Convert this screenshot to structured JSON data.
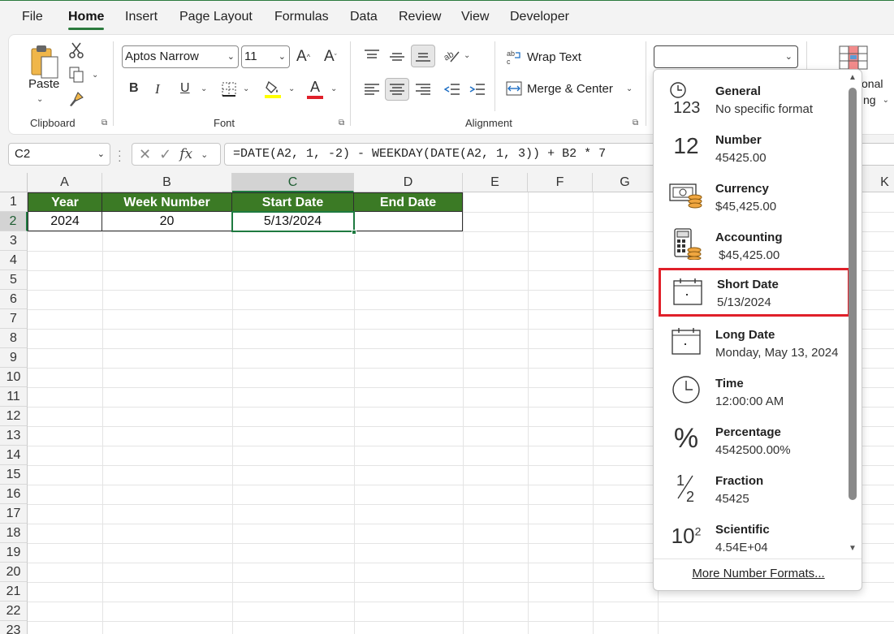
{
  "tabs": [
    "File",
    "Home",
    "Insert",
    "Page Layout",
    "Formulas",
    "Data",
    "Review",
    "View",
    "Developer"
  ],
  "ribbon": {
    "clipboard": {
      "paste_label": "Paste",
      "group_label": "Clipboard"
    },
    "font": {
      "font_name": "Aptos Narrow",
      "font_size": "11",
      "group_label": "Font",
      "bold": "B",
      "italic": "I",
      "underline": "U",
      "grow": "A",
      "shrink": "A",
      "font_color_letter": "A"
    },
    "alignment": {
      "wrap_text": "Wrap Text",
      "merge_center": "Merge & Center",
      "group_label": "Alignment"
    },
    "number": {
      "format_value": ""
    },
    "styles": {
      "conditional_partial_1": "onal",
      "conditional_partial_2": "ng"
    },
    "colors": {
      "fill_color": "#ffff00",
      "font_color": "#e0202a",
      "accent": "#2b7a3d"
    }
  },
  "formula_bar": {
    "name_box": "C2",
    "fx": "fx",
    "formula": "=DATE(A2, 1, -2) - WEEKDAY(DATE(A2, 1, 3)) + B2 * 7"
  },
  "grid": {
    "columns": [
      "A",
      "B",
      "C",
      "D",
      "E",
      "F",
      "G",
      "K"
    ],
    "rows": [
      "1",
      "2",
      "3",
      "4",
      "5",
      "6",
      "7",
      "8",
      "9",
      "10",
      "11",
      "12",
      "13",
      "14",
      "15",
      "16",
      "17",
      "18",
      "19",
      "20",
      "21",
      "22",
      "23"
    ],
    "header_cells": [
      "Year",
      "Week Number",
      "Start Date",
      "End Date"
    ],
    "data_cells": [
      "2024",
      "20",
      "5/13/2024",
      ""
    ],
    "header_fill": "#3b7a25"
  },
  "number_formats": {
    "options": [
      {
        "name": "General",
        "sample": "No specific format",
        "icon": "clock-123-icon"
      },
      {
        "name": "Number",
        "sample": "45425.00",
        "icon": "number-12-icon"
      },
      {
        "name": "Currency",
        "sample": "$45,425.00",
        "icon": "currency-bill-coins-icon"
      },
      {
        "name": "Accounting",
        "sample": " $45,425.00",
        "icon": "accounting-calculator-icon"
      },
      {
        "name": "Short Date",
        "sample": "5/13/2024",
        "icon": "calendar-icon"
      },
      {
        "name": "Long Date",
        "sample": "Monday, May 13, 2024",
        "icon": "calendar-icon"
      },
      {
        "name": "Time",
        "sample": "12:00:00 AM",
        "icon": "clock-icon"
      },
      {
        "name": "Percentage",
        "sample": "4542500.00%",
        "icon": "percent-icon"
      },
      {
        "name": "Fraction",
        "sample": "45425",
        "icon": "fraction-icon"
      },
      {
        "name": "Scientific",
        "sample": "4.54E+04",
        "icon": "scientific-icon"
      }
    ],
    "icon_text": {
      "general": "123",
      "number": "12",
      "percent": "%",
      "fraction_num": "1",
      "fraction_den": "2",
      "sci_base": "10",
      "sci_exp": "2"
    },
    "highlighted": "Short Date",
    "highlight_color": "#e0202a",
    "more_label": "More Number Formats..."
  }
}
